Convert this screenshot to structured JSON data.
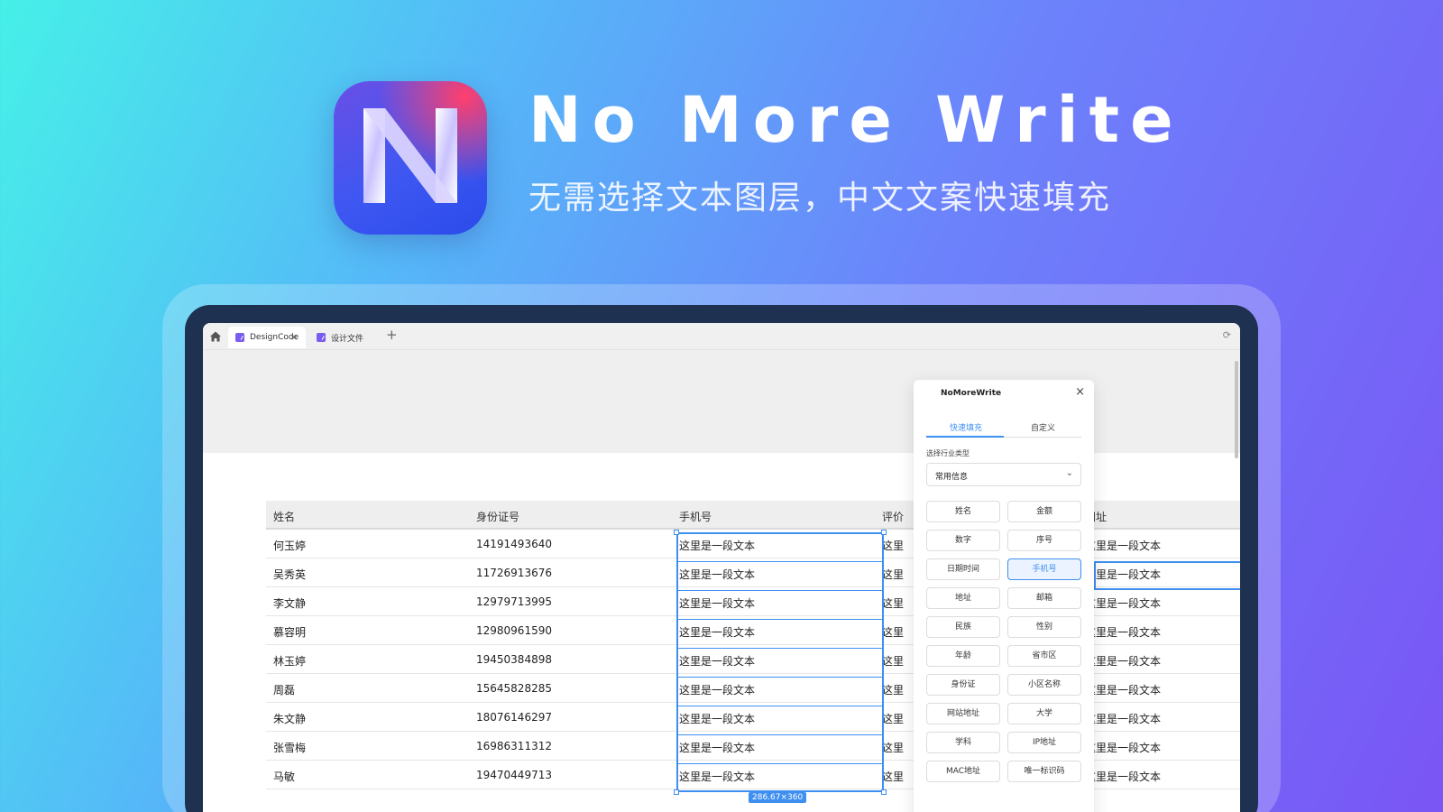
{
  "hero": {
    "title": "No More Write",
    "subtitle": "无需选择文本图层，中文文案快速填充"
  },
  "browser": {
    "tabs": [
      {
        "label": "DesignCode",
        "active": true
      },
      {
        "label": "设计文件",
        "active": false
      }
    ],
    "plus": "+",
    "close": "×",
    "refresh": "⟳"
  },
  "table": {
    "headers": [
      "姓名",
      "身份证号",
      "手机号",
      "评价",
      "网址"
    ],
    "rows": [
      {
        "name": "何玉婷",
        "id": "14191493640",
        "phone": "这里是一段文本",
        "review": "这里",
        "url": "这里是一段文本"
      },
      {
        "name": "吴秀英",
        "id": "11726913676",
        "phone": "这里是一段文本",
        "review": "这里",
        "url": "这里是一段文本"
      },
      {
        "name": "李文静",
        "id": "12979713995",
        "phone": "这里是一段文本",
        "review": "这里",
        "url": "这里是一段文本"
      },
      {
        "name": "慕容明",
        "id": "12980961590",
        "phone": "这里是一段文本",
        "review": "这里",
        "url": "这里是一段文本"
      },
      {
        "name": "林玉婷",
        "id": "19450384898",
        "phone": "这里是一段文本",
        "review": "这里",
        "url": "这里是一段文本"
      },
      {
        "name": "周磊",
        "id": "15645828285",
        "phone": "这里是一段文本",
        "review": "这里",
        "url": "这里是一段文本"
      },
      {
        "name": "朱文静",
        "id": "18076146297",
        "phone": "这里是一段文本",
        "review": "这里",
        "url": "这里是一段文本"
      },
      {
        "name": "张雪梅",
        "id": "16986311312",
        "phone": "这里是一段文本",
        "review": "这里",
        "url": "这里是一段文本"
      },
      {
        "name": "马敏",
        "id": "19470449713",
        "phone": "这里是一段文本",
        "review": "这里",
        "url": "这里是一段文本"
      }
    ],
    "selection_size": "286.67×360"
  },
  "panel": {
    "title": "NoMoreWrite",
    "close": "×",
    "tabs": [
      "快速填充",
      "自定义"
    ],
    "industry_label": "选择行业类型",
    "industry_value": "常用信息",
    "buttons": [
      {
        "label": "姓名"
      },
      {
        "label": "金额"
      },
      {
        "label": "数字"
      },
      {
        "label": "序号"
      },
      {
        "label": "日期时间"
      },
      {
        "label": "手机号",
        "active": true
      },
      {
        "label": "地址"
      },
      {
        "label": "邮箱"
      },
      {
        "label": "民族"
      },
      {
        "label": "性别"
      },
      {
        "label": "年龄"
      },
      {
        "label": "省市区"
      },
      {
        "label": "身份证"
      },
      {
        "label": "小区名称"
      },
      {
        "label": "网站地址"
      },
      {
        "label": "大学"
      },
      {
        "label": "学科"
      },
      {
        "label": "IP地址"
      },
      {
        "label": "MAC地址"
      },
      {
        "label": "唯一标识码"
      }
    ]
  }
}
